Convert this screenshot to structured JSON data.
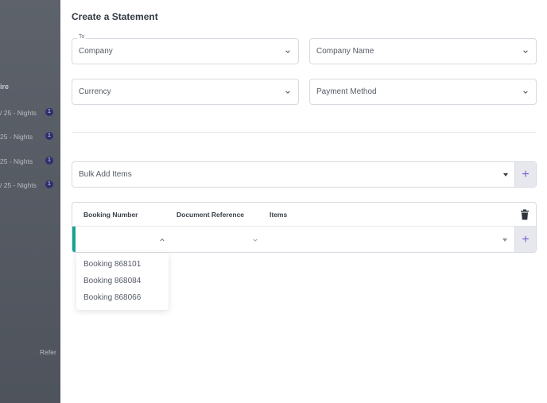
{
  "background": {
    "heading": "ire",
    "rows": [
      {
        "text": "/ 25 - Nights",
        "badge": "1"
      },
      {
        "text": "25 - Nights",
        "badge": "1"
      },
      {
        "text": "25 - Nights",
        "badge": "1"
      },
      {
        "text": "/ 25 - Nights",
        "badge": "1"
      }
    ],
    "ref_label": "Refer"
  },
  "panel": {
    "title": "Create a Statement",
    "to_label": "To",
    "company_select": "Company",
    "company_name_select": "Company Name",
    "currency_select": "Currency",
    "payment_method_select": "Payment Method",
    "bulk_add": "Bulk Add Items",
    "table": {
      "headers": [
        "Booking Number",
        "Document Reference",
        "Items"
      ]
    },
    "dropdown_options": [
      "Booking 868101",
      "Booking 868084",
      "Booking 868066"
    ]
  },
  "colors": {
    "accent": "#1aa394",
    "plus": "#7b5cd6",
    "badge": "#2f2f6e"
  },
  "icons": {
    "chevron": "chevron-down-icon",
    "plus": "plus-icon",
    "trash": "trash-icon"
  }
}
